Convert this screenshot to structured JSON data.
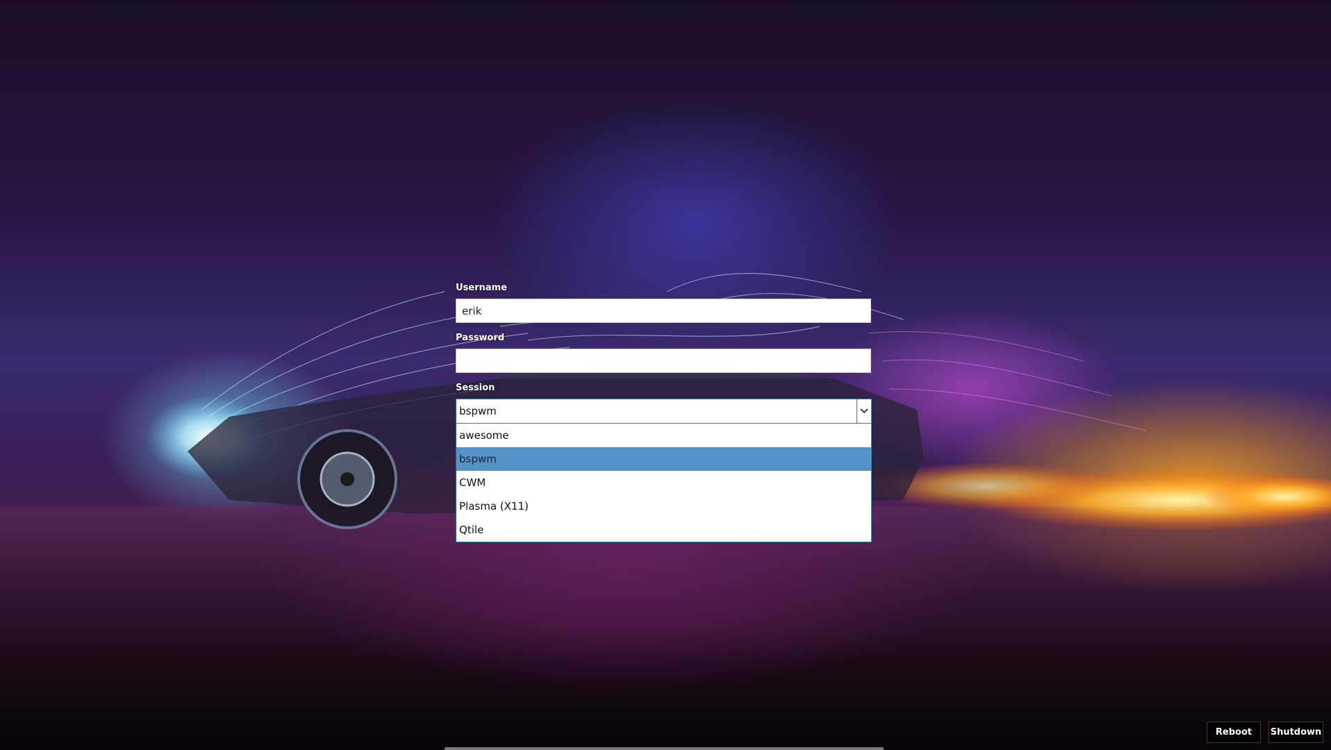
{
  "login": {
    "username_label": "Username",
    "username_value": "erik",
    "password_label": "Password",
    "password_value": "",
    "session_label": "Session",
    "session_selected": "bspwm",
    "session_options": [
      "awesome",
      "bspwm",
      "CWM",
      "Plasma (X11)",
      "Qtile"
    ],
    "session_highlighted_index": 1
  },
  "power": {
    "reboot_label": "Reboot",
    "shutdown_label": "Shutdown"
  },
  "colors": {
    "dropdown_highlight": "#5592c7",
    "dropdown_border": "#3f6f9c"
  },
  "icons": {
    "session_dropdown": "chevron-down-icon"
  }
}
